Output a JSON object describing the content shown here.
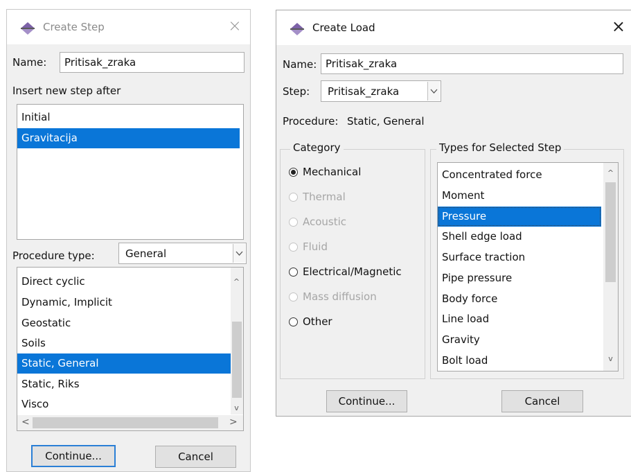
{
  "create_step": {
    "title": "Create Step",
    "close_glyph": "×",
    "name_label": "Name:",
    "name_value": "Pritisak_zraka",
    "insert_after_label": "Insert new step after",
    "steps": [
      "Initial",
      "Gravitacija"
    ],
    "selected_step": "Gravitacija",
    "procedure_type_label": "Procedure type:",
    "procedure_type_value": "General",
    "procedures": [
      "Direct cyclic",
      "Dynamic, Implicit",
      "Geostatic",
      "Soils",
      "Static, General",
      "Static, Riks",
      "Visco"
    ],
    "selected_procedure": "Static, General",
    "continue_label": "Continue...",
    "cancel_label": "Cancel",
    "scroll_left_glyph": "<",
    "scroll_right_glyph": ">",
    "scroll_up_glyph": "^",
    "scroll_down_glyph": "v"
  },
  "create_load": {
    "title": "Create Load",
    "close_glyph": "×",
    "name_label": "Name:",
    "name_value": "Pritisak_zraka",
    "step_label": "Step:",
    "step_value": "Pritisak_zraka",
    "procedure_label": "Procedure:",
    "procedure_value": "Static, General",
    "category_label": "Category",
    "categories": [
      {
        "label": "Mechanical",
        "checked": true,
        "enabled": true
      },
      {
        "label": "Thermal",
        "checked": false,
        "enabled": false
      },
      {
        "label": "Acoustic",
        "checked": false,
        "enabled": false
      },
      {
        "label": "Fluid",
        "checked": false,
        "enabled": false
      },
      {
        "label": "Electrical/Magnetic",
        "checked": false,
        "enabled": true
      },
      {
        "label": "Mass diffusion",
        "checked": false,
        "enabled": false
      },
      {
        "label": "Other",
        "checked": false,
        "enabled": true
      }
    ],
    "types_label": "Types for Selected Step",
    "types": [
      "Concentrated force",
      "Moment",
      "Pressure",
      "Shell edge load",
      "Surface traction",
      "Pipe pressure",
      "Body force",
      "Line load",
      "Gravity",
      "Bolt load"
    ],
    "selected_type": "Pressure",
    "continue_label": "Continue...",
    "cancel_label": "Cancel",
    "scroll_up_glyph": "^",
    "scroll_down_glyph": "v"
  },
  "colors": {
    "selection": "#0a76d8",
    "dialog_bg": "#f0f0f0",
    "default_button_border": "#2a7fd6"
  },
  "icons": {
    "title_icon": "abaqus-step-arrows-icon",
    "combo_arrow": "chevron-down-icon"
  }
}
